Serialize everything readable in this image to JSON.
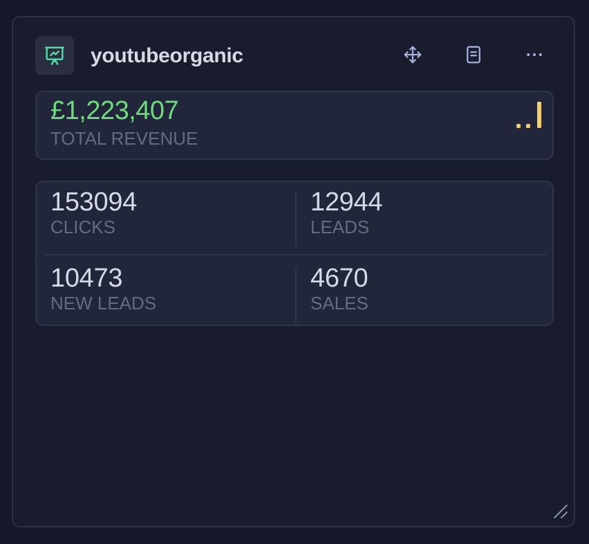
{
  "widget": {
    "title": "youtubeorganic",
    "icon": "presentation-chart-icon",
    "accent_color": "#4fe0a6",
    "actions": [
      {
        "name": "move-button",
        "icon": "move-arrows-icon"
      },
      {
        "name": "notes-button",
        "icon": "document-icon"
      },
      {
        "name": "more-button",
        "icon": "ellipsis-icon"
      }
    ]
  },
  "revenue": {
    "value": "£1,223,407",
    "label": "TOTAL REVENUE",
    "value_color": "#6ddc7a",
    "signal_color": "#f2d16b"
  },
  "stats": [
    {
      "value": "153094",
      "label": "CLICKS"
    },
    {
      "value": "12944",
      "label": "LEADS"
    },
    {
      "value": "10473",
      "label": "NEW LEADS"
    },
    {
      "value": "4670",
      "label": "SALES"
    }
  ]
}
